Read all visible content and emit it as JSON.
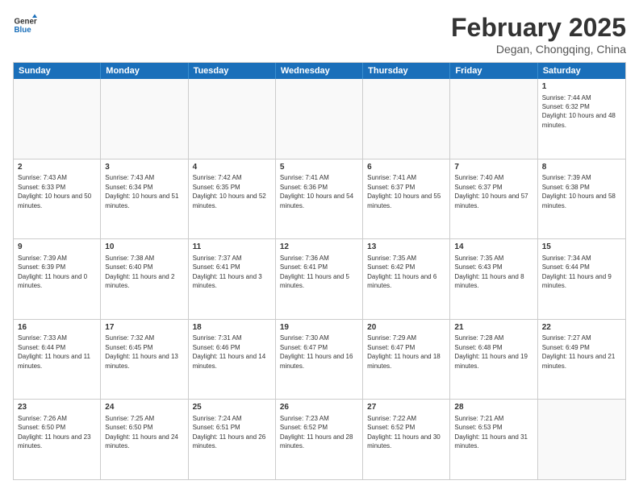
{
  "logo": {
    "line1": "General",
    "line2": "Blue"
  },
  "title": "February 2025",
  "subtitle": "Degan, Chongqing, China",
  "weekdays": [
    "Sunday",
    "Monday",
    "Tuesday",
    "Wednesday",
    "Thursday",
    "Friday",
    "Saturday"
  ],
  "weeks": [
    [
      {
        "day": "",
        "text": ""
      },
      {
        "day": "",
        "text": ""
      },
      {
        "day": "",
        "text": ""
      },
      {
        "day": "",
        "text": ""
      },
      {
        "day": "",
        "text": ""
      },
      {
        "day": "",
        "text": ""
      },
      {
        "day": "1",
        "text": "Sunrise: 7:44 AM\nSunset: 6:32 PM\nDaylight: 10 hours and 48 minutes."
      }
    ],
    [
      {
        "day": "2",
        "text": "Sunrise: 7:43 AM\nSunset: 6:33 PM\nDaylight: 10 hours and 50 minutes."
      },
      {
        "day": "3",
        "text": "Sunrise: 7:43 AM\nSunset: 6:34 PM\nDaylight: 10 hours and 51 minutes."
      },
      {
        "day": "4",
        "text": "Sunrise: 7:42 AM\nSunset: 6:35 PM\nDaylight: 10 hours and 52 minutes."
      },
      {
        "day": "5",
        "text": "Sunrise: 7:41 AM\nSunset: 6:36 PM\nDaylight: 10 hours and 54 minutes."
      },
      {
        "day": "6",
        "text": "Sunrise: 7:41 AM\nSunset: 6:37 PM\nDaylight: 10 hours and 55 minutes."
      },
      {
        "day": "7",
        "text": "Sunrise: 7:40 AM\nSunset: 6:37 PM\nDaylight: 10 hours and 57 minutes."
      },
      {
        "day": "8",
        "text": "Sunrise: 7:39 AM\nSunset: 6:38 PM\nDaylight: 10 hours and 58 minutes."
      }
    ],
    [
      {
        "day": "9",
        "text": "Sunrise: 7:39 AM\nSunset: 6:39 PM\nDaylight: 11 hours and 0 minutes."
      },
      {
        "day": "10",
        "text": "Sunrise: 7:38 AM\nSunset: 6:40 PM\nDaylight: 11 hours and 2 minutes."
      },
      {
        "day": "11",
        "text": "Sunrise: 7:37 AM\nSunset: 6:41 PM\nDaylight: 11 hours and 3 minutes."
      },
      {
        "day": "12",
        "text": "Sunrise: 7:36 AM\nSunset: 6:41 PM\nDaylight: 11 hours and 5 minutes."
      },
      {
        "day": "13",
        "text": "Sunrise: 7:35 AM\nSunset: 6:42 PM\nDaylight: 11 hours and 6 minutes."
      },
      {
        "day": "14",
        "text": "Sunrise: 7:35 AM\nSunset: 6:43 PM\nDaylight: 11 hours and 8 minutes."
      },
      {
        "day": "15",
        "text": "Sunrise: 7:34 AM\nSunset: 6:44 PM\nDaylight: 11 hours and 9 minutes."
      }
    ],
    [
      {
        "day": "16",
        "text": "Sunrise: 7:33 AM\nSunset: 6:44 PM\nDaylight: 11 hours and 11 minutes."
      },
      {
        "day": "17",
        "text": "Sunrise: 7:32 AM\nSunset: 6:45 PM\nDaylight: 11 hours and 13 minutes."
      },
      {
        "day": "18",
        "text": "Sunrise: 7:31 AM\nSunset: 6:46 PM\nDaylight: 11 hours and 14 minutes."
      },
      {
        "day": "19",
        "text": "Sunrise: 7:30 AM\nSunset: 6:47 PM\nDaylight: 11 hours and 16 minutes."
      },
      {
        "day": "20",
        "text": "Sunrise: 7:29 AM\nSunset: 6:47 PM\nDaylight: 11 hours and 18 minutes."
      },
      {
        "day": "21",
        "text": "Sunrise: 7:28 AM\nSunset: 6:48 PM\nDaylight: 11 hours and 19 minutes."
      },
      {
        "day": "22",
        "text": "Sunrise: 7:27 AM\nSunset: 6:49 PM\nDaylight: 11 hours and 21 minutes."
      }
    ],
    [
      {
        "day": "23",
        "text": "Sunrise: 7:26 AM\nSunset: 6:50 PM\nDaylight: 11 hours and 23 minutes."
      },
      {
        "day": "24",
        "text": "Sunrise: 7:25 AM\nSunset: 6:50 PM\nDaylight: 11 hours and 24 minutes."
      },
      {
        "day": "25",
        "text": "Sunrise: 7:24 AM\nSunset: 6:51 PM\nDaylight: 11 hours and 26 minutes."
      },
      {
        "day": "26",
        "text": "Sunrise: 7:23 AM\nSunset: 6:52 PM\nDaylight: 11 hours and 28 minutes."
      },
      {
        "day": "27",
        "text": "Sunrise: 7:22 AM\nSunset: 6:52 PM\nDaylight: 11 hours and 30 minutes."
      },
      {
        "day": "28",
        "text": "Sunrise: 7:21 AM\nSunset: 6:53 PM\nDaylight: 11 hours and 31 minutes."
      },
      {
        "day": "",
        "text": ""
      }
    ]
  ]
}
